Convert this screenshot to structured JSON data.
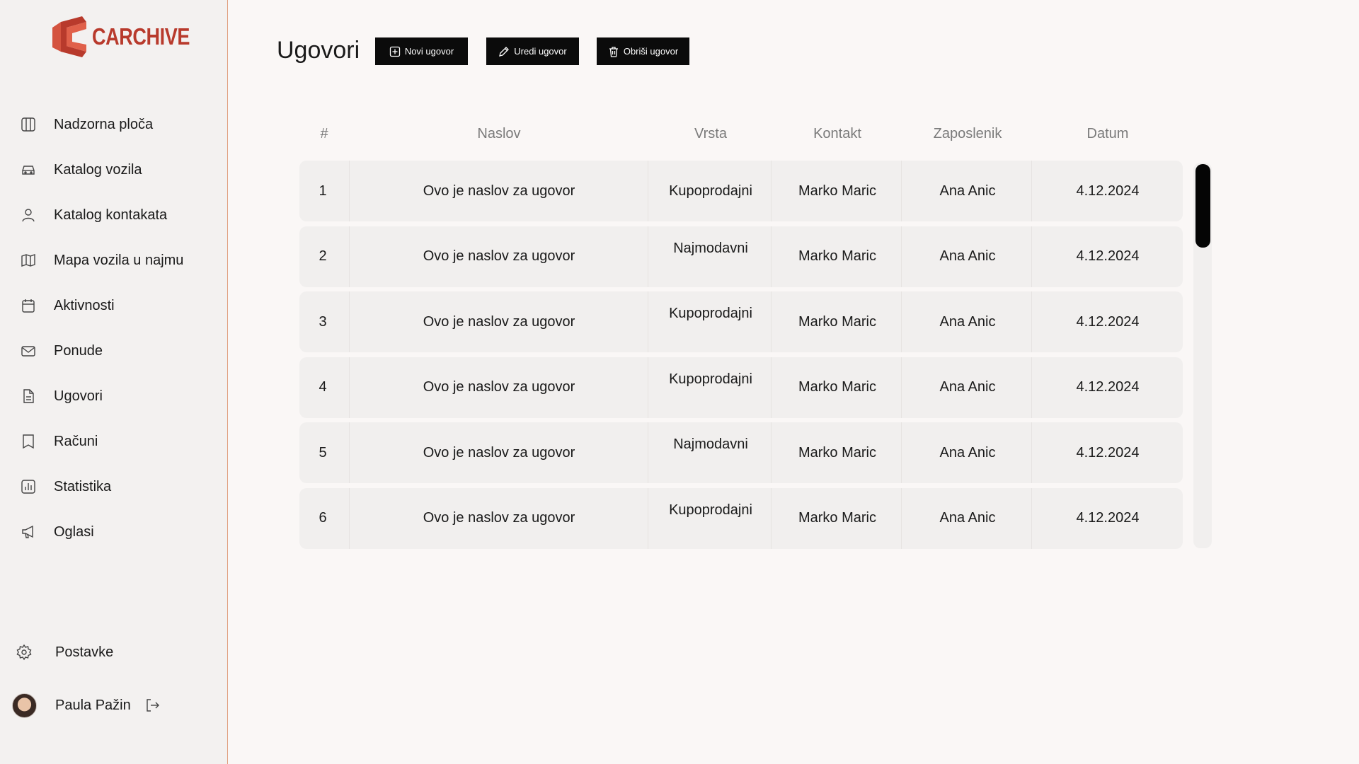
{
  "brand": {
    "name": "CARCHIVE",
    "color": "#b83a2c"
  },
  "sidebar": {
    "items": [
      {
        "label": "Nadzorna ploča",
        "icon": "dashboard-icon"
      },
      {
        "label": "Katalog vozila",
        "icon": "car-icon"
      },
      {
        "label": "Katalog kontakata",
        "icon": "user-icon"
      },
      {
        "label": "Mapa vozila u najmu",
        "icon": "map-icon"
      },
      {
        "label": "Aktivnosti",
        "icon": "calendar-icon"
      },
      {
        "label": "Ponude",
        "icon": "mail-icon"
      },
      {
        "label": "Ugovori",
        "icon": "document-icon"
      },
      {
        "label": "Računi",
        "icon": "receipt-icon"
      },
      {
        "label": "Statistika",
        "icon": "chart-icon"
      },
      {
        "label": "Oglasi",
        "icon": "megaphone-icon"
      }
    ],
    "settings": {
      "label": "Postavke",
      "icon": "gear-icon"
    },
    "user": {
      "name": "Paula Pažin",
      "logout_icon": "logout-icon"
    }
  },
  "page": {
    "title": "Ugovori",
    "buttons": {
      "new": "Novi ugovor",
      "edit": "Uredi ugovor",
      "delete": "Obriši ugovor"
    }
  },
  "table": {
    "columns": [
      "#",
      "Naslov",
      "Vrsta",
      "Kontakt",
      "Zaposlenik",
      "Datum"
    ],
    "rows": [
      {
        "num": "1",
        "title": "Ovo je naslov za ugovor",
        "type": "Kupoprodajni",
        "contact": "Marko Maric",
        "employee": "Ana Anic",
        "date": "4.12.2024"
      },
      {
        "num": "2",
        "title": "Ovo je naslov za ugovor",
        "type": "Najmodavni",
        "contact": "Marko Maric",
        "employee": "Ana Anic",
        "date": "4.12.2024"
      },
      {
        "num": "3",
        "title": "Ovo je naslov za ugovor",
        "type": "Kupoprodajni",
        "contact": "Marko Maric",
        "employee": "Ana Anic",
        "date": "4.12.2024"
      },
      {
        "num": "4",
        "title": "Ovo je naslov za ugovor",
        "type": "Kupoprodajni",
        "contact": "Marko Maric",
        "employee": "Ana Anic",
        "date": "4.12.2024"
      },
      {
        "num": "5",
        "title": "Ovo je naslov za ugovor",
        "type": "Najmodavni",
        "contact": "Marko Maric",
        "employee": "Ana Anic",
        "date": "4.12.2024"
      },
      {
        "num": "6",
        "title": "Ovo je naslov za ugovor",
        "type": "Kupoprodajni",
        "contact": "Marko Maric",
        "employee": "Ana Anic",
        "date": "4.12.2024"
      }
    ]
  }
}
